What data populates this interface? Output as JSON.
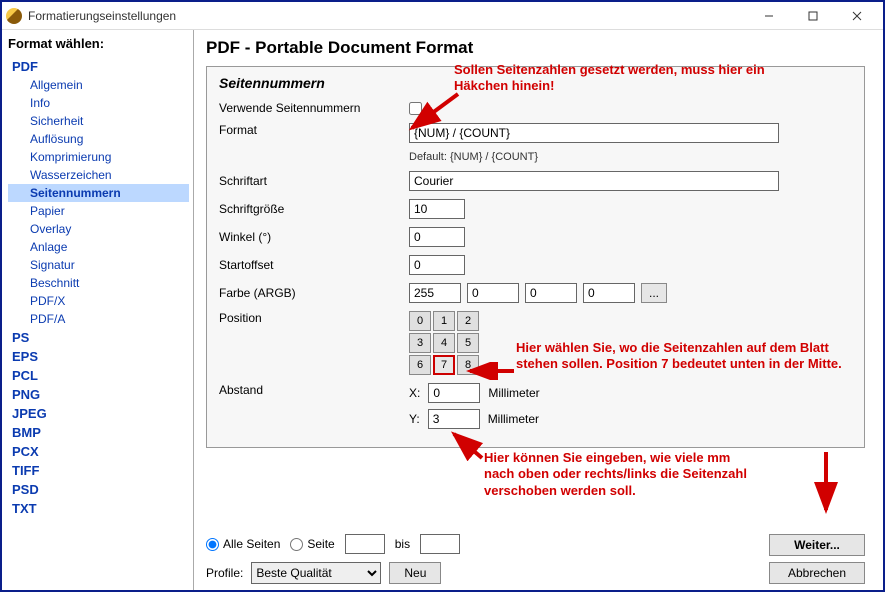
{
  "window": {
    "title": "Formatierungseinstellungen"
  },
  "sidebar": {
    "heading": "Format wählen:",
    "items": [
      {
        "label": "PDF",
        "type": "top",
        "subs": [
          "Allgemein",
          "Info",
          "Sicherheit",
          "Auflösung",
          "Komprimierung",
          "Wasserzeichen",
          "Seitennummern",
          "Papier",
          "Overlay",
          "Anlage",
          "Signatur",
          "Beschnitt",
          "PDF/X",
          "PDF/A"
        ],
        "selected": "Seitennummern"
      },
      {
        "label": "PS",
        "type": "top"
      },
      {
        "label": "EPS",
        "type": "top"
      },
      {
        "label": "PCL",
        "type": "top"
      },
      {
        "label": "PNG",
        "type": "top"
      },
      {
        "label": "JPEG",
        "type": "top"
      },
      {
        "label": "BMP",
        "type": "top"
      },
      {
        "label": "PCX",
        "type": "top"
      },
      {
        "label": "TIFF",
        "type": "top"
      },
      {
        "label": "PSD",
        "type": "top"
      },
      {
        "label": "TXT",
        "type": "top"
      }
    ]
  },
  "page": {
    "title": "PDF - Portable Document Format",
    "panel_title": "Seitennummern",
    "rows": {
      "use_pagenumbers": {
        "label": "Verwende Seitennummern"
      },
      "format": {
        "label": "Format",
        "value": "{NUM} / {COUNT}",
        "default": "Default: {NUM} / {COUNT}"
      },
      "font": {
        "label": "Schriftart",
        "value": "Courier"
      },
      "fontsize": {
        "label": "Schriftgröße",
        "value": "10"
      },
      "angle": {
        "label": "Winkel (°)",
        "value": "0"
      },
      "startoffset": {
        "label": "Startoffset",
        "value": "0"
      },
      "color": {
        "label": "Farbe (ARGB)",
        "a": "255",
        "r": "0",
        "g": "0",
        "b": "0",
        "dots": "..."
      },
      "position": {
        "label": "Position",
        "cells": [
          "0",
          "1",
          "2",
          "3",
          "4",
          "5",
          "6",
          "7",
          "8"
        ],
        "selected": "7"
      },
      "distance": {
        "label": "Abstand",
        "xlabel": "X:",
        "x": "0",
        "ylabel": "Y:",
        "y": "3",
        "unit": "Millimeter"
      }
    }
  },
  "bottom": {
    "all_pages": "Alle Seiten",
    "page": "Seite",
    "to": "bis",
    "profile_label": "Profile:",
    "profile_value": "Beste Qualität",
    "new": "Neu",
    "next": "Weiter...",
    "cancel": "Abbrechen"
  },
  "annotations": {
    "a1": "Sollen Seitenzahlen gesetzt werden, muss hier ein Häkchen hinein!",
    "a2": "Hier wählen Sie, wo die Seitenzahlen auf dem Blatt stehen sollen. Position 7 bedeutet unten in der Mitte.",
    "a3": "Hier können Sie eingeben, wie viele mm nach oben oder rechts/links die Seitenzahl verschoben werden soll."
  }
}
